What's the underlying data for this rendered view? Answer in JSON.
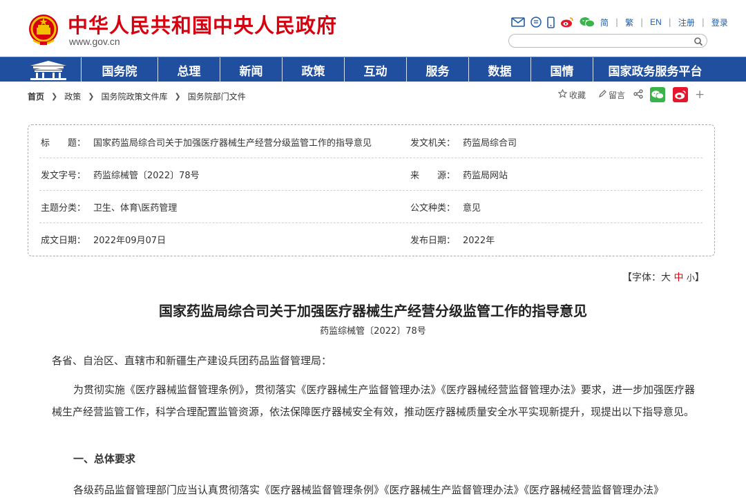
{
  "header": {
    "site_title": "中华人民共和国中央人民政府",
    "site_url": "www.gov.cn",
    "lang_links": [
      "简",
      "繁",
      "EN"
    ],
    "account_links": [
      "注册",
      "登录"
    ],
    "search_placeholder": ""
  },
  "nav": {
    "items": [
      "国务院",
      "总理",
      "新闻",
      "政策",
      "互动",
      "服务",
      "数据",
      "国情",
      "国家政务服务平台"
    ]
  },
  "breadcrumb": [
    "首页",
    "政策",
    "国务院政策文件库",
    "国务院部门文件"
  ],
  "share": {
    "favorite_label": "收藏",
    "comment_label": "留言"
  },
  "info": {
    "rows": [
      {
        "l_label": "标　　题：",
        "l_value": "国家药监局综合司关于加强医疗器械生产经营分级监管工作的指导意见",
        "r_label": "发文机关：",
        "r_value": "药监局综合司"
      },
      {
        "l_label": "发文字号：",
        "l_value": "药监综械管〔2022〕78号",
        "r_label": "来　　源：",
        "r_value": "药监局网站"
      },
      {
        "l_label": "主题分类：",
        "l_value": "卫生、体育\\医药管理",
        "r_label": "公文种类：",
        "r_value": "意见"
      },
      {
        "l_label": "成文日期：",
        "l_value": "2022年09月07日",
        "r_label": "发布日期：",
        "r_value": "2022年"
      }
    ]
  },
  "font_size": {
    "open": "【字体：",
    "large": "大",
    "medium": "中",
    "small": "小",
    "close": "】"
  },
  "article": {
    "title": "国家药监局综合司关于加强医疗器械生产经营分级监管工作的指导意见",
    "doc_no": "药监综械管〔2022〕78号",
    "salutation": "各省、自治区、直辖市和新疆生产建设兵团药品监督管理局：",
    "intro": "为贯彻实施《医疗器械监督管理条例》，贯彻落实《医疗器械生产监督管理办法》《医疗器械经营监督管理办法》要求，进一步加强医疗器械生产经营监管工作，科学合理配置监管资源，依法保障医疗器械安全有效，推动医疗器械质量安全水平实现新提升，现提出以下指导意见。",
    "section1": "一、总体要求",
    "section1_text": "各级药品监督管理部门应当认真贯彻落实《医疗器械监督管理条例》《医疗器械生产监督管理办法》《医疗器械经营监督管理办法》"
  },
  "colors": {
    "brand_red": "#d7000f",
    "nav_blue": "#1f4f9e",
    "link_blue": "#1f5ca8",
    "wechat_green": "#3ab44a",
    "weibo_red": "#e6162d"
  }
}
